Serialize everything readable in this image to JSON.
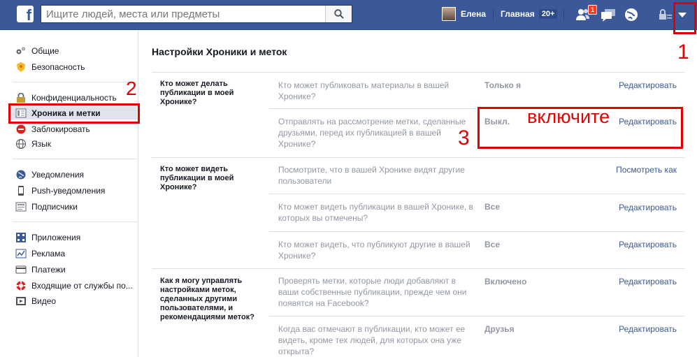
{
  "header": {
    "logo_letter": "f",
    "search_placeholder": "Ищите людей, места или предметы",
    "user_name": "Елена",
    "home_label": "Главная",
    "home_count": "20+",
    "friend_requests_badge": "1",
    "brand_color": "#3b5998"
  },
  "sidebar": {
    "groups": [
      [
        {
          "label": "Общие",
          "icon": "gears-icon"
        },
        {
          "label": "Безопасность",
          "icon": "badge-icon"
        }
      ],
      [
        {
          "label": "Конфиденциальность",
          "icon": "lock-icon"
        },
        {
          "label": "Хроника и метки",
          "icon": "timeline-icon",
          "active": true
        },
        {
          "label": "Заблокировать",
          "icon": "block-icon"
        },
        {
          "label": "Язык",
          "icon": "globe-icon"
        }
      ],
      [
        {
          "label": "Уведомления",
          "icon": "globe-notif-icon"
        },
        {
          "label": "Push-уведомления",
          "icon": "phone-icon"
        },
        {
          "label": "Подписчики",
          "icon": "rss-icon"
        }
      ],
      [
        {
          "label": "Приложения",
          "icon": "apps-icon"
        },
        {
          "label": "Реклама",
          "icon": "ads-icon"
        },
        {
          "label": "Платежи",
          "icon": "payments-icon"
        },
        {
          "label": "Входящие от службы по...",
          "icon": "lifebuoy-icon"
        },
        {
          "label": "Видео",
          "icon": "video-icon"
        }
      ]
    ]
  },
  "main": {
    "title": "Настройки Хроники и меток",
    "sections": [
      {
        "label": "Кто может делать публикации в моей Хронике?",
        "rows": [
          {
            "question": "Кто может публиковать материалы в вашей Хронике?",
            "value": "Только я",
            "action": "Редактировать"
          },
          {
            "question": "Отправлять на рассмотрение метки, сделанные друзьями, перед их публикацией в вашей Хронике?",
            "value": "Выкл.",
            "action": "Редактировать"
          }
        ]
      },
      {
        "label": "Кто может видеть публикации в моей Хронике?",
        "rows": [
          {
            "question": "Посмотрите, что в вашей Хронике видят другие пользователи",
            "value": "",
            "action": "Посмотреть как"
          },
          {
            "question": "Кто может видеть публикации в вашей Хронике, в которых вы отмечены?",
            "value": "Все",
            "action": "Редактировать"
          },
          {
            "question": "Кто может видеть, что публикуют другие в вашей Хронике?",
            "value": "Все",
            "action": "Редактировать"
          }
        ]
      },
      {
        "label": "Как я могу управлять настройками меток, сделанных другими пользователями, и рекомендациями меток?",
        "rows": [
          {
            "question": "Проверять метки, которые люди добавляют в ваши собственные публикации, прежде чем они появятся на Facebook?",
            "value": "Включено",
            "action": "Редактировать"
          },
          {
            "question": "Когда вас отмечают в публикации, кто может ее видеть, кроме тех людей, для которых она уже открыта?",
            "value": "Друзья",
            "action": "Редактировать"
          }
        ]
      }
    ]
  },
  "annotations": {
    "step1": "1",
    "step2": "2",
    "step3": "3",
    "hint": "включите",
    "color": "#e30000"
  }
}
